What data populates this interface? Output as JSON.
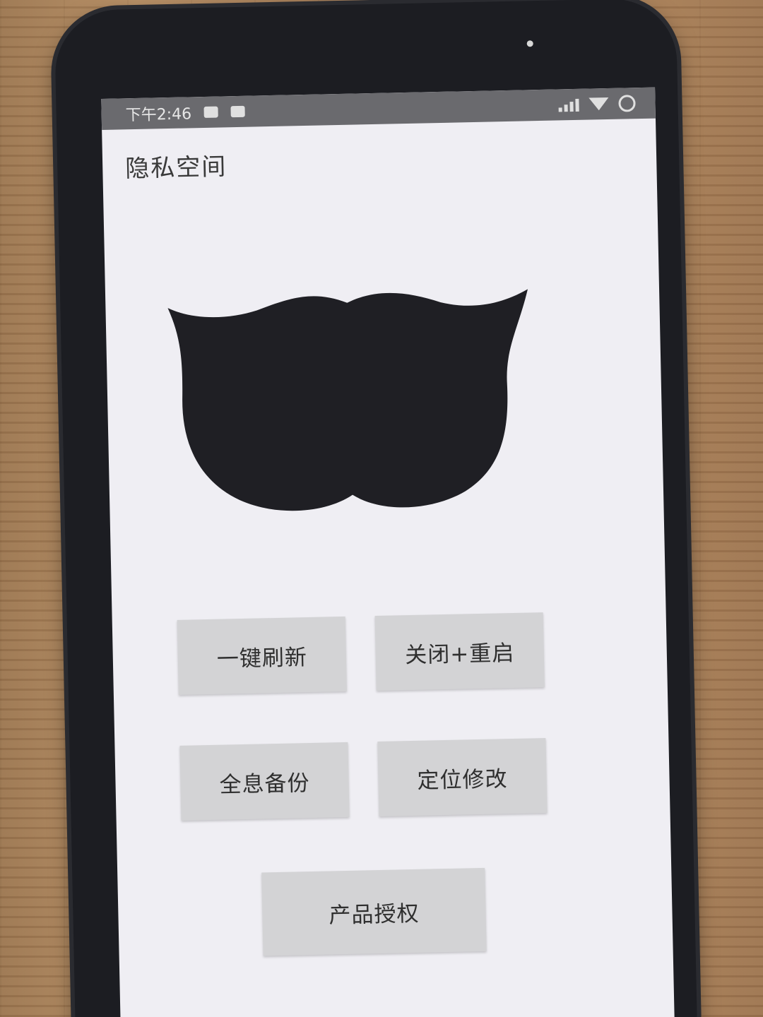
{
  "status_bar": {
    "time": "下午2:46",
    "icons_left": [
      "notification-icon",
      "message-icon"
    ],
    "icons_right": [
      "signal-icon",
      "wifi-icon",
      "battery-icon"
    ]
  },
  "app": {
    "title": "隐私空间"
  },
  "hero": {
    "icon": "mask-icon",
    "color": "#1f1f24"
  },
  "buttons": {
    "refresh": "一键刷新",
    "restart": "关闭+重启",
    "backup": "全息备份",
    "location": "定位修改",
    "license": "产品授权"
  },
  "colors": {
    "screen_bg": "#efeef3",
    "button_bg": "#d3d3d5",
    "status_bar_bg": "#6a6a6e"
  }
}
